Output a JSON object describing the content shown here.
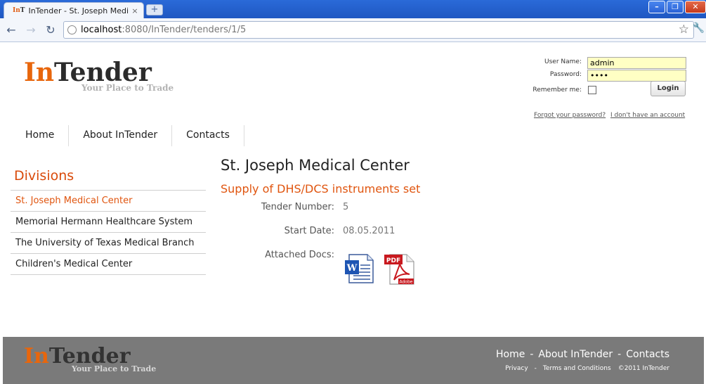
{
  "browser": {
    "tab_title": "InTender - St. Joseph Medi...",
    "tab_close": "×",
    "new_tab": "+",
    "url_host": "localhost",
    "url_rest": ":8080/InTender/tenders/1/5",
    "star": "☆"
  },
  "header": {
    "logo_in": "In",
    "logo_tender": "Tender",
    "tagline": "Your Place to Trade"
  },
  "login": {
    "username_label": "User Name:",
    "username_value": "admin",
    "password_label": "Password:",
    "password_value": "••••",
    "remember_label": "Remember me:",
    "login_button": "Login",
    "forgot_link": "Forgot your password?",
    "no_account_link": "I don't have an account"
  },
  "nav": {
    "items": [
      {
        "label": "Home"
      },
      {
        "label": "About InTender"
      },
      {
        "label": "Contacts"
      }
    ]
  },
  "sidebar": {
    "title": "Divisions",
    "items": [
      {
        "label": "St. Joseph Medical Center",
        "active": true
      },
      {
        "label": "Memorial Hermann Healthcare System"
      },
      {
        "label": "The University of Texas Medical Branch"
      },
      {
        "label": "Children's Medical Center"
      }
    ]
  },
  "main": {
    "title": "St. Joseph Medical Center",
    "subtitle": "Supply of DHS/DCS instruments set",
    "fields": [
      {
        "label": "Tender Number:",
        "value": "5"
      },
      {
        "label": "Start Date:",
        "value": "08.05.2011"
      },
      {
        "label": "Attached Docs:",
        "value": ""
      }
    ],
    "docs": [
      {
        "icon": "word-document-icon",
        "label": "W"
      },
      {
        "icon": "pdf-document-icon",
        "label": "PDF",
        "brand": "Adobe"
      }
    ]
  },
  "footer": {
    "logo_in": "In",
    "logo_tender": "Tender",
    "tagline": "Your Place to Trade",
    "nav": [
      "Home",
      "About InTender",
      "Contacts"
    ],
    "nav_sep": "-",
    "legal": [
      "Privacy",
      "Terms and Conditions",
      "©2011 InTender"
    ],
    "legal_sep": "-"
  },
  "colors": {
    "accent": "#e0550f",
    "footer_bg": "#7a7a7a",
    "login_field_bg": "#ffffc4"
  }
}
